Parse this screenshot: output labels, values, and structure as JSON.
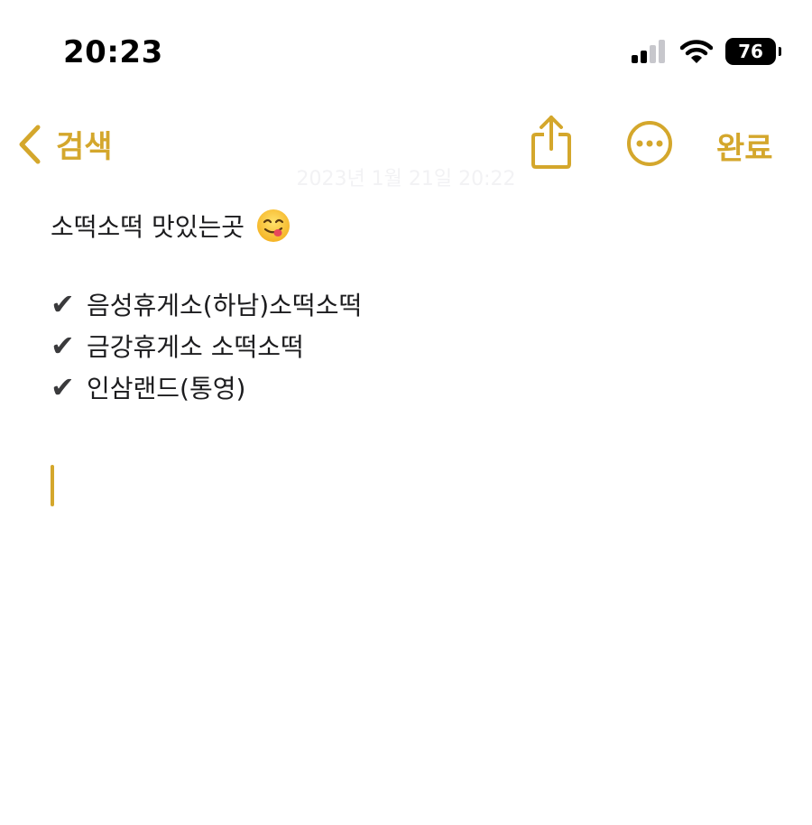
{
  "status_bar": {
    "time": "20:23",
    "battery": "76"
  },
  "nav": {
    "back_label": "검색",
    "done_label": "완료"
  },
  "note": {
    "date": "2023년 1월 21일 20:22",
    "title": "소떡소떡 맛있는곳",
    "checkmark": "✔",
    "items": [
      "음성휴게소(하남)소떡소떡",
      "금강휴게소 소떡소떡",
      "인삼랜드(통영)"
    ]
  },
  "colors": {
    "accent": "#d4a72c",
    "text": "#1c1c1e"
  },
  "icons": [
    "signal-icon",
    "wifi-icon",
    "battery-icon",
    "chevron-left-icon",
    "share-icon",
    "more-icon",
    "yum-face-emoji-icon",
    "checkmark-icon"
  ]
}
